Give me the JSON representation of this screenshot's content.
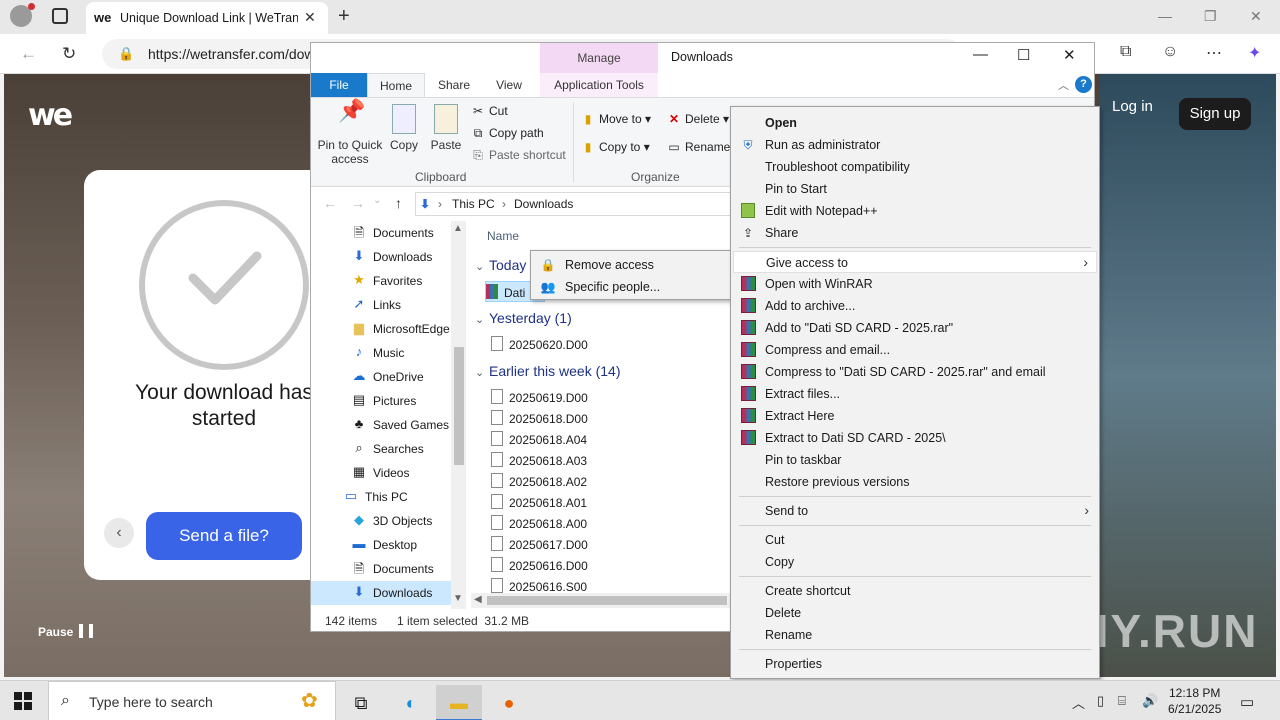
{
  "browser": {
    "tab_title": "Unique Download Link | WeTransfer",
    "tab_favicon": "we",
    "url": "https://wetransfer.com/downloads"
  },
  "page": {
    "logo": "we",
    "login": "Log in",
    "signup": "Sign up",
    "download_line1": "Your download has",
    "download_line2": "started",
    "send_button": "Send a file?",
    "pause": "Pause",
    "watermark": "ANY.RUN"
  },
  "explorer": {
    "window_title": "Downloads",
    "manage_tab": "Manage",
    "tabs": {
      "file": "File",
      "home": "Home",
      "share": "Share",
      "view": "View",
      "app_tools": "Application Tools"
    },
    "ribbon": {
      "pin": "Pin to Quick access",
      "copy": "Copy",
      "paste": "Paste",
      "cut": "Cut",
      "copy_path": "Copy path",
      "paste_shortcut": "Paste shortcut",
      "clipboard": "Clipboard",
      "move_to": "Move to",
      "copy_to": "Copy to",
      "delete": "Delete",
      "rename": "Rename",
      "organize": "Organize"
    },
    "breadcrumb": [
      "This PC",
      "Downloads"
    ],
    "nav_items": [
      {
        "label": "Documents",
        "icon": "documents-icon"
      },
      {
        "label": "Downloads",
        "icon": "downloads-icon"
      },
      {
        "label": "Favorites",
        "icon": "favorites-icon"
      },
      {
        "label": "Links",
        "icon": "links-icon"
      },
      {
        "label": "MicrosoftEdge",
        "icon": "folder-icon"
      },
      {
        "label": "Music",
        "icon": "music-icon"
      },
      {
        "label": "OneDrive",
        "icon": "onedrive-icon"
      },
      {
        "label": "Pictures",
        "icon": "pictures-icon"
      },
      {
        "label": "Saved Games",
        "icon": "saved-games-icon"
      },
      {
        "label": "Searches",
        "icon": "searches-icon"
      },
      {
        "label": "Videos",
        "icon": "videos-icon"
      },
      {
        "label": "This PC",
        "icon": "this-pc-icon"
      },
      {
        "label": "3D Objects",
        "icon": "3d-objects-icon"
      },
      {
        "label": "Desktop",
        "icon": "desktop-icon"
      },
      {
        "label": "Documents",
        "icon": "documents-icon"
      },
      {
        "label": "Downloads",
        "icon": "downloads-icon"
      }
    ],
    "column_name": "Name",
    "group_today": "Today",
    "today_file": "Dati",
    "group_yesterday": "Yesterday (1)",
    "yesterday_files": [
      "20250620.D00"
    ],
    "group_week": "Earlier this week (14)",
    "week_files": [
      "20250619.D00",
      "20250618.D00",
      "20250618.A04",
      "20250618.A03",
      "20250618.A02",
      "20250618.A01",
      "20250618.A00",
      "20250617.D00",
      "20250616.D00",
      "20250616.S00"
    ],
    "status_items": "142 items",
    "status_selected": "1 item selected  31.2 MB"
  },
  "submenu": [
    "Remove access",
    "Specific people..."
  ],
  "context_menu": {
    "open": "Open",
    "run_admin": "Run as administrator",
    "troubleshoot": "Troubleshoot compatibility",
    "pin_start": "Pin to Start",
    "notepad": "Edit with Notepad++",
    "share": "Share",
    "give_access": "Give access to",
    "winrar_open": "Open with WinRAR",
    "add_archive": "Add to archive...",
    "add_rar": "Add to \"Dati SD CARD - 2025.rar\"",
    "compress_email": "Compress and email...",
    "compress_rar_email": "Compress to \"Dati SD CARD - 2025.rar\" and email",
    "extract_files": "Extract files...",
    "extract_here": "Extract Here",
    "extract_to": "Extract to Dati SD CARD - 2025\\",
    "pin_taskbar": "Pin to taskbar",
    "restore": "Restore previous versions",
    "send_to": "Send to",
    "cut": "Cut",
    "copy": "Copy",
    "create_shortcut": "Create shortcut",
    "delete": "Delete",
    "rename": "Rename",
    "properties": "Properties"
  },
  "taskbar": {
    "search_placeholder": "Type here to search",
    "time": "12:18 PM",
    "date": "6/21/2025"
  }
}
